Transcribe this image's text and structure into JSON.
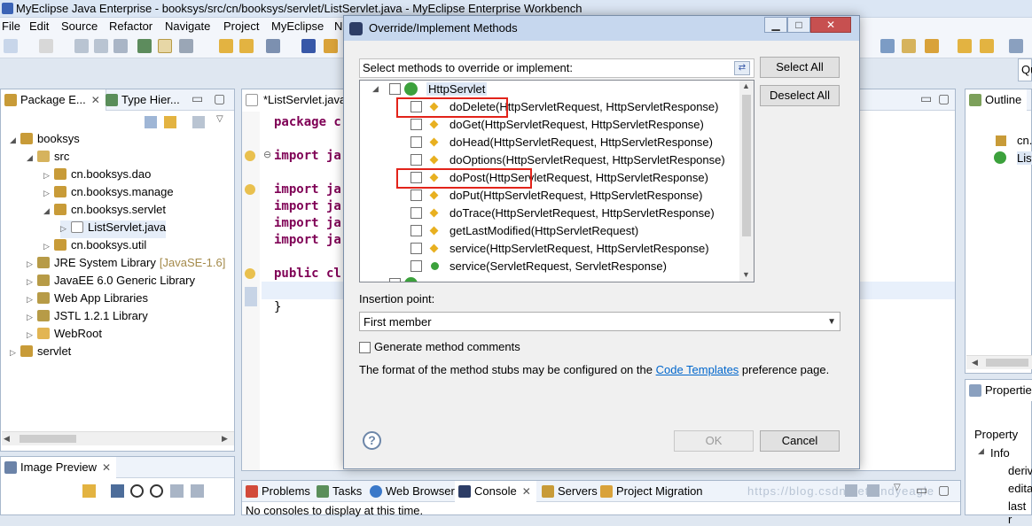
{
  "window": {
    "title": "MyEclipse Java Enterprise - booksys/src/cn/booksys/servlet/ListServlet.java - MyEclipse Enterprise Workbench"
  },
  "menu": [
    "File",
    "Edit",
    "Source",
    "Refactor",
    "Navigate",
    "Project",
    "MyEclipse",
    "N"
  ],
  "toolbar_search_partial": "Qu",
  "package_explorer": {
    "tab_label": "Package E...",
    "second_tab_label": "Type Hier...",
    "tree": [
      {
        "label": "booksys",
        "depth": 0,
        "arrow": "◢"
      },
      {
        "label": "src",
        "depth": 1,
        "arrow": "◢"
      },
      {
        "label": "cn.booksys.dao",
        "depth": 2,
        "arrow": "▷"
      },
      {
        "label": "cn.booksys.manage",
        "depth": 2,
        "arrow": "▷"
      },
      {
        "label": "cn.booksys.servlet",
        "depth": 2,
        "arrow": "◢"
      },
      {
        "label": "ListServlet.java",
        "depth": 3,
        "arrow": "▷"
      },
      {
        "label": "cn.booksys.util",
        "depth": 2,
        "arrow": "▷"
      },
      {
        "label": "JRE System Library",
        "suffix": "[JavaSE-1.6]",
        "depth": 1,
        "arrow": "▷"
      },
      {
        "label": "JavaEE 6.0 Generic Library",
        "depth": 1,
        "arrow": "▷"
      },
      {
        "label": "Web App Libraries",
        "depth": 1,
        "arrow": "▷"
      },
      {
        "label": "JSTL 1.2.1 Library",
        "depth": 1,
        "arrow": "▷"
      },
      {
        "label": "WebRoot",
        "depth": 1,
        "arrow": "▷"
      },
      {
        "label": "servlet",
        "depth": 0,
        "arrow": "▷"
      }
    ]
  },
  "editor": {
    "tab_label": "*ListServlet.java",
    "lines": [
      "package c",
      "import ja",
      "import ja",
      "import ja",
      "import ja",
      "import ja",
      "public cl",
      "}"
    ]
  },
  "outline": {
    "tab_label": "Outline",
    "items": [
      "cn.",
      "List"
    ]
  },
  "properties": {
    "tab_label": "Properties",
    "column_header": "Property",
    "rows": [
      "Info",
      "deriv",
      "edita",
      "last r"
    ]
  },
  "image_preview": {
    "tab_label": "Image Preview"
  },
  "console": {
    "tabs": [
      "Problems",
      "Tasks",
      "Web Browser",
      "Console",
      "Servers",
      "Project Migration"
    ],
    "message": "No consoles to display at this time.",
    "watermark": "https://blog.csdn.net/andyeagle"
  },
  "dialog": {
    "title": "Override/Implement Methods",
    "instruction": "Select methods to override or implement:",
    "select_all": "Select All",
    "deselect_all": "Deselect All",
    "class_node": "HttpServlet",
    "methods": [
      {
        "label": "doDelete(HttpServletRequest, HttpServletResponse)",
        "icon": "protected-method-icon",
        "highlighted": true
      },
      {
        "label": "doGet(HttpServletRequest, HttpServletResponse)",
        "icon": "protected-method-icon",
        "highlighted": false
      },
      {
        "label": "doHead(HttpServletRequest, HttpServletResponse)",
        "icon": "protected-method-icon",
        "highlighted": false
      },
      {
        "label": "doOptions(HttpServletRequest, HttpServletResponse)",
        "icon": "protected-method-icon",
        "highlighted": false
      },
      {
        "label": "doPost(HttpServletRequest, HttpServletResponse)",
        "icon": "protected-method-icon",
        "highlighted": true
      },
      {
        "label": "doPut(HttpServletRequest, HttpServletResponse)",
        "icon": "protected-method-icon",
        "highlighted": false
      },
      {
        "label": "doTrace(HttpServletRequest, HttpServletResponse)",
        "icon": "protected-method-icon",
        "highlighted": false
      },
      {
        "label": "getLastModified(HttpServletRequest)",
        "icon": "protected-method-icon",
        "highlighted": false
      },
      {
        "label": "service(HttpServletRequest, HttpServletResponse)",
        "icon": "protected-method-icon",
        "highlighted": false
      },
      {
        "label": "service(ServletRequest, ServletResponse)",
        "icon": "public-method-icon",
        "highlighted": false
      }
    ],
    "insertion_label": "Insertion point:",
    "insertion_value": "First member",
    "generate_comments_label": "Generate method comments",
    "stub_text_before": "The format of the method stubs may be configured on the ",
    "stub_link": "Code Templates",
    "stub_text_after": " preference page.",
    "ok_label": "OK",
    "cancel_label": "Cancel"
  },
  "colors": {
    "highlight_box": "#e2231a",
    "link": "#0066cc",
    "keyword": "#7f0055",
    "titlebar": "#dbe6f4"
  }
}
